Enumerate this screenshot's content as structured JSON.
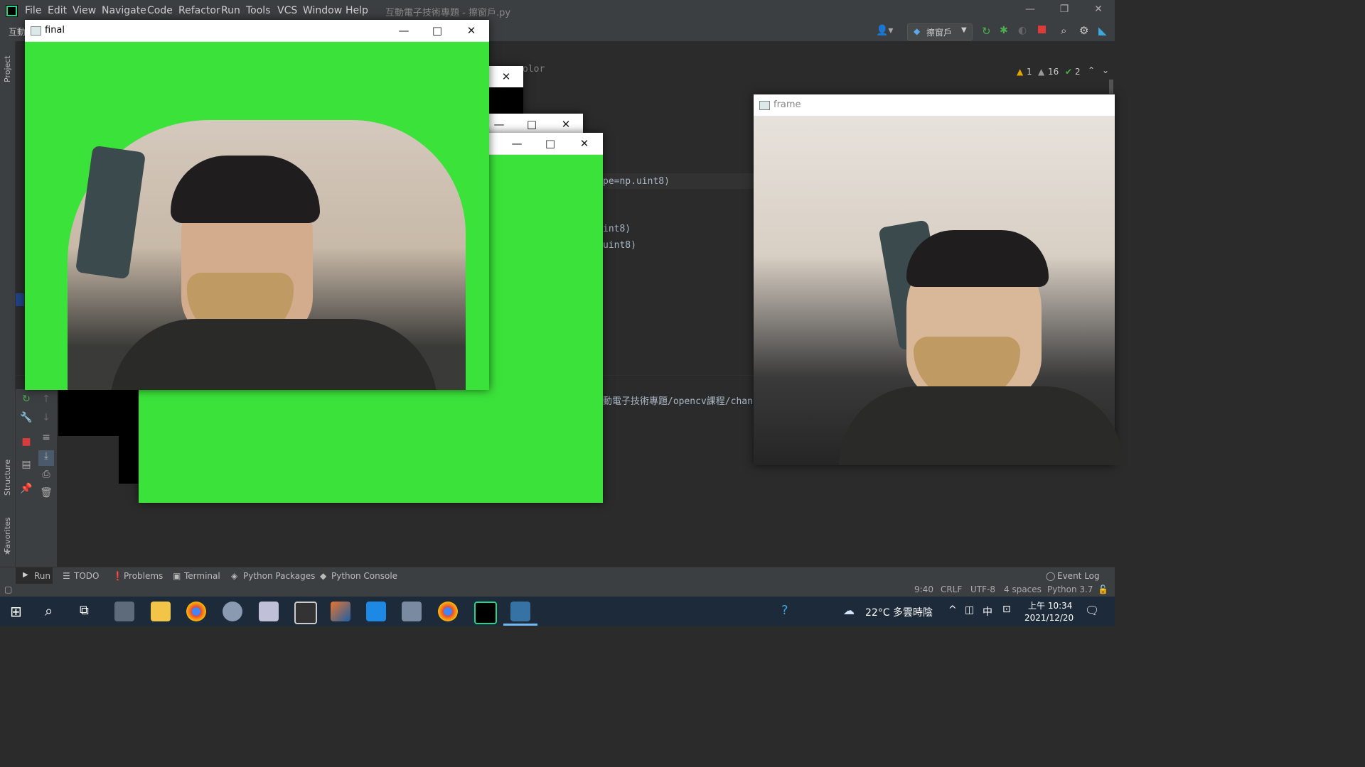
{
  "ide": {
    "menu": [
      "File",
      "Edit",
      "View",
      "Navigate",
      "Code",
      "Refactor",
      "Run",
      "Tools",
      "VCS",
      "Window",
      "Help"
    ],
    "title": "互動電子技術專題 - 擦窗戶.py",
    "project_short": "互動",
    "run_config": "擦窗戶",
    "inspections": {
      "warnings": "1",
      "weak": "16",
      "ok": "2"
    },
    "code_fragments": [
      "olor",
      "pe=np.uint8)",
      "int8)",
      "uint8)"
    ],
    "run_path": "動電子技術專題/opencv課程/chan"
  },
  "side_labels": {
    "project": "Project",
    "structure": "Structure",
    "favorites": "Favorites"
  },
  "bottom_tabs": [
    "Run",
    "TODO",
    "Problems",
    "Terminal",
    "Python Packages",
    "Python Console"
  ],
  "event_log": "Event Log",
  "status": {
    "position": "9:40",
    "line_sep": "CRLF",
    "encoding": "UTF-8",
    "indent": "4 spaces",
    "interpreter": "Python 3.7"
  },
  "windows": {
    "final_title": "final",
    "frame_title": "frame"
  },
  "taskbar": {
    "weather": "22°C 多雲時陰",
    "ime": "中",
    "time": "上午 10:34",
    "date": "2021/12/20"
  },
  "colors": {
    "green_screen": "#3be23a",
    "ide_bg": "#2b2b2b"
  }
}
